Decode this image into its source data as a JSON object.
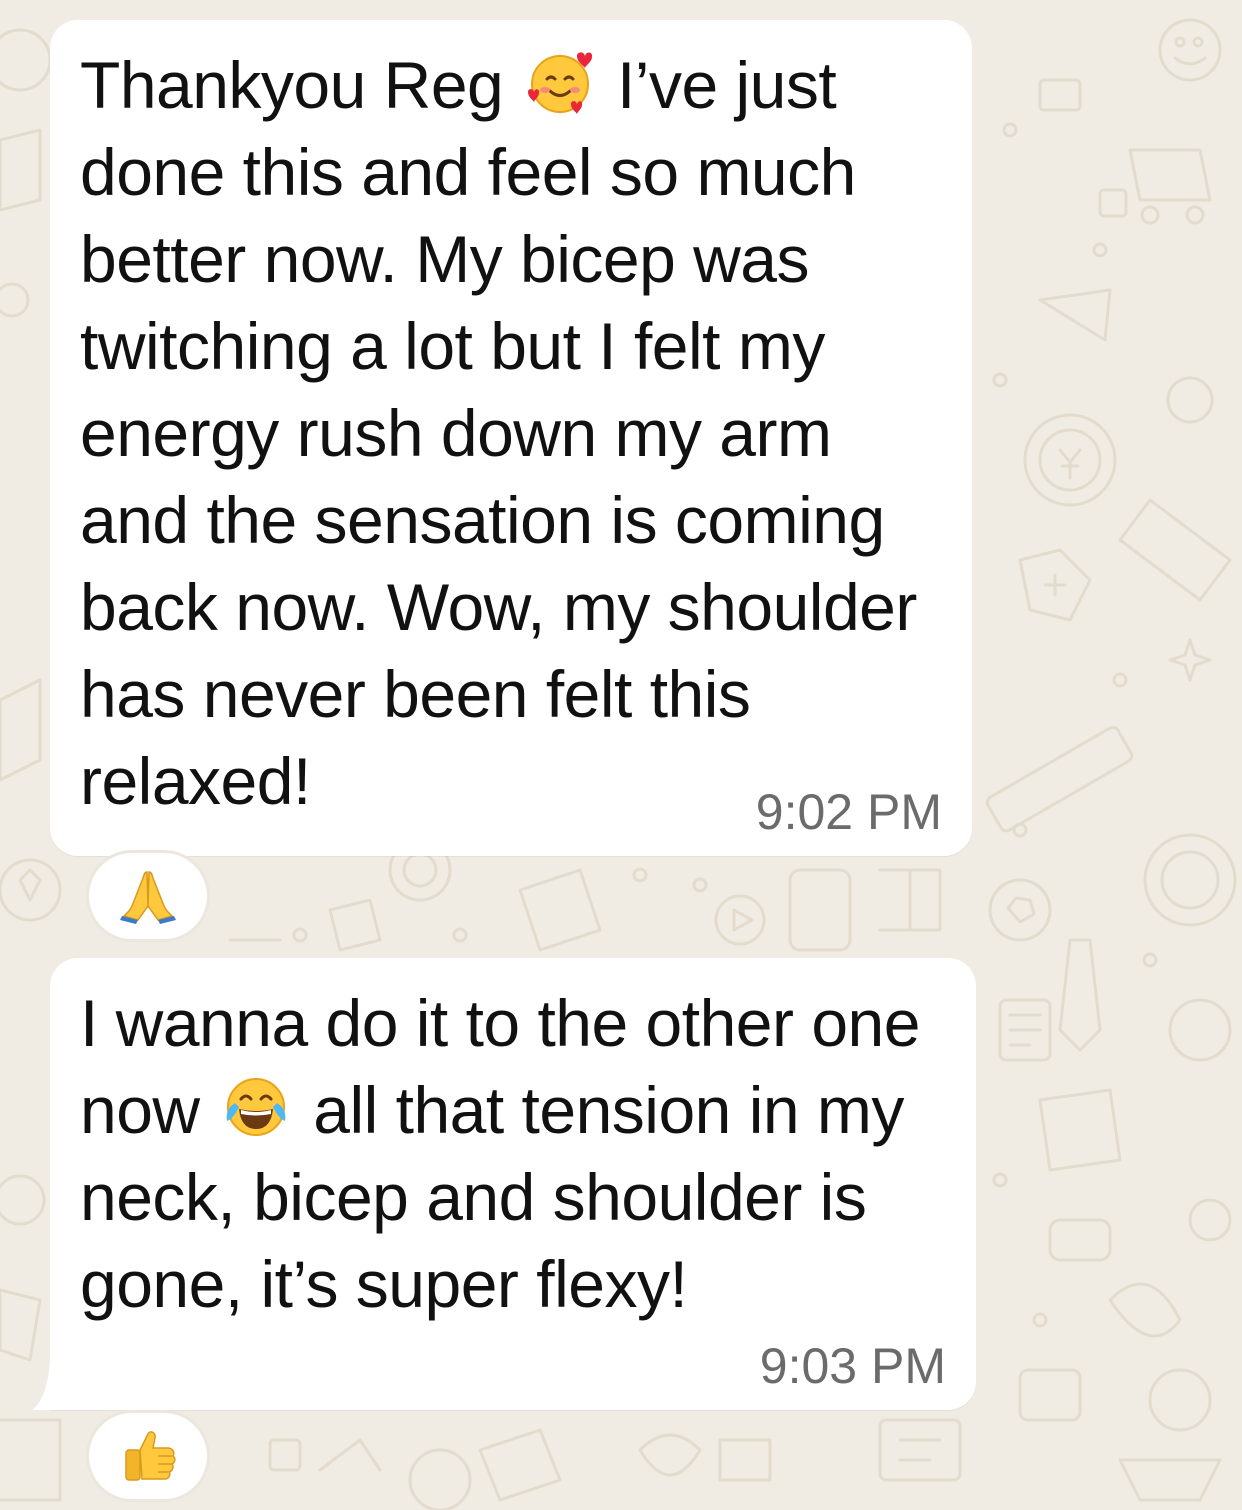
{
  "colors": {
    "wallpaper": "#F1ECE3",
    "wallpaper_doodle": "#E3DBCD",
    "bubble": "#FFFFFF",
    "text": "#111111",
    "timestamp": "#6B6B6B"
  },
  "messages": [
    {
      "segments": {
        "before_emoji": "Thankyou Reg ",
        "emoji_name": "smiling-face-with-hearts-icon",
        "after_emoji": " I’ve just\ndone this and feel so much\nbetter now. My bicep was\ntwitching a lot but I felt my\nenergy rush down my arm\nand the sensation is coming\nback now. Wow, my shoulder\nhas never been felt this\nrelaxed!"
      },
      "time": "9:02 PM",
      "reaction": "folded-hands-icon"
    },
    {
      "segments": {
        "before_emoji": "I wanna do it to the other one\nnow ",
        "emoji_name": "face-with-tears-of-joy-icon",
        "after_emoji": " all that tension in my\nneck, bicep and shoulder is\ngone, it’s super flexy!"
      },
      "time": "9:03 PM",
      "reaction": "thumbs-up-icon"
    }
  ]
}
